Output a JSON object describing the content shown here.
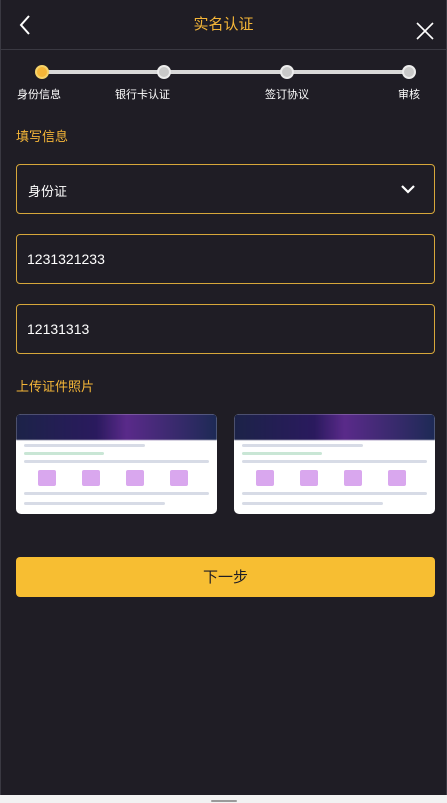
{
  "header": {
    "title": "实名认证",
    "back_icon": "chevron-left-icon",
    "close_icon": "close-icon"
  },
  "steps": {
    "current_index": 0,
    "items": [
      {
        "label": "身份信息"
      },
      {
        "label": "银行卡认证"
      },
      {
        "label": "签订协议"
      },
      {
        "label": "审核"
      }
    ]
  },
  "form": {
    "section_title": "填写信息",
    "id_type": {
      "value": "身份证",
      "icon": "chevron-down-icon"
    },
    "id_number": {
      "value": "1231321233"
    },
    "second_field": {
      "value": "12131313"
    }
  },
  "upload": {
    "section_title": "上传证件照片"
  },
  "actions": {
    "next_label": "下一步"
  },
  "colors": {
    "accent": "#f5b638",
    "button": "#f7be32",
    "background": "#1f1d25",
    "border": "#d6a73a"
  }
}
